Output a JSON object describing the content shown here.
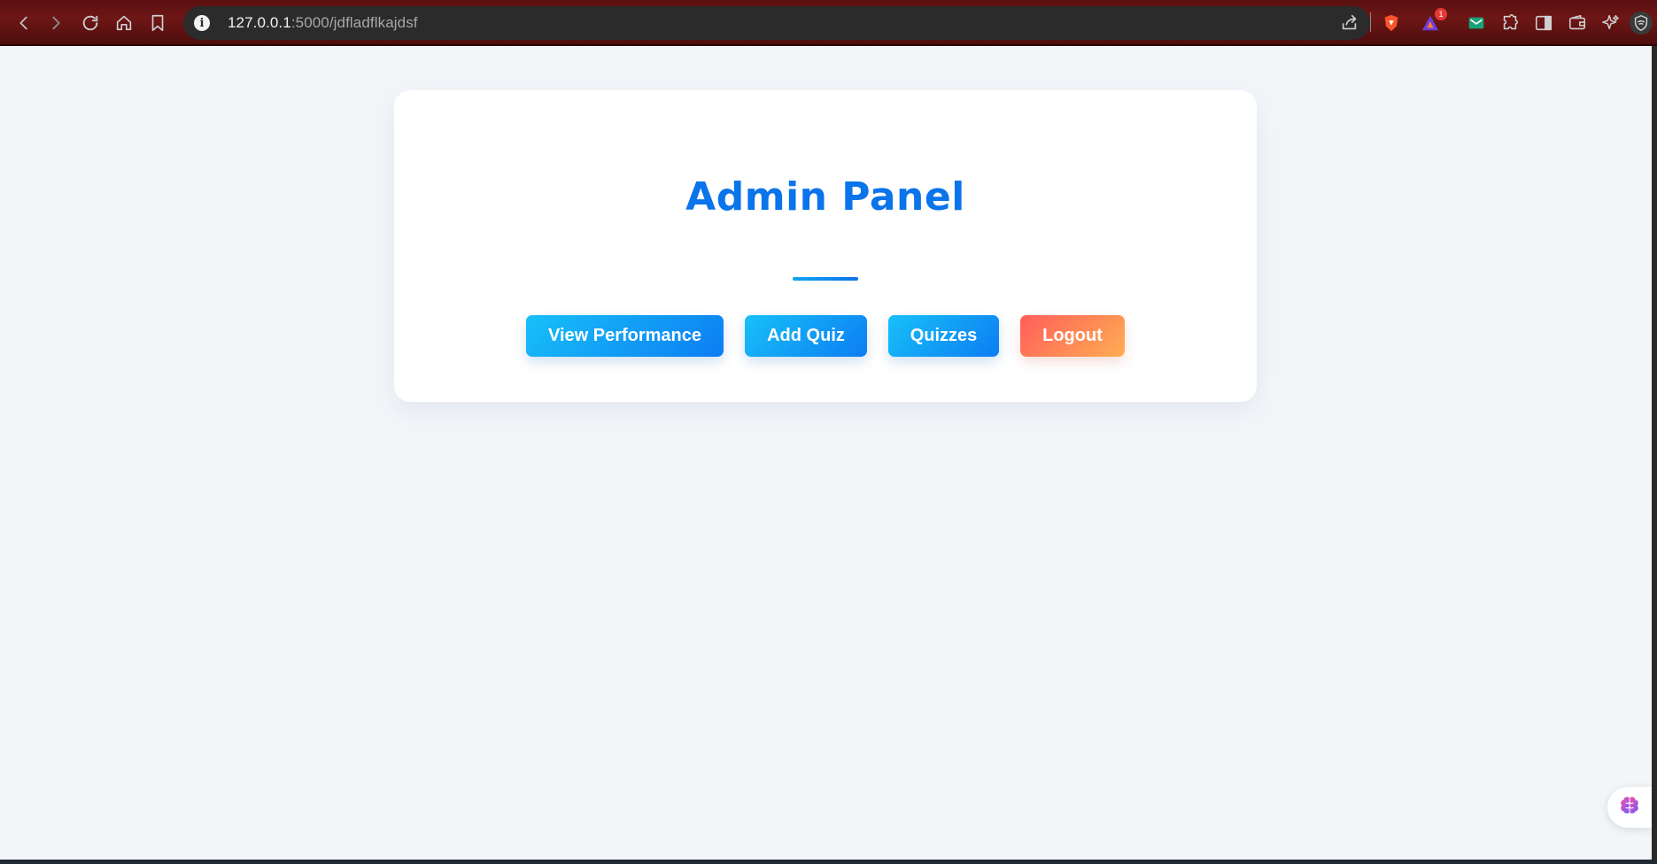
{
  "browser": {
    "url_host": "127.0.0.1",
    "url_path": ":5000/jdfladflkajdsf",
    "notification_count": "1",
    "icons": [
      "back-icon",
      "forward-icon",
      "reload-icon",
      "home-icon",
      "bookmark-icon",
      "info-icon",
      "share-icon",
      "brave-shields-icon",
      "brave-rewards-icon",
      "email-extension-icon",
      "extensions-icon",
      "sidebar-icon",
      "wallet-icon",
      "leo-ai-icon",
      "vpn-icon"
    ]
  },
  "page": {
    "title": "Admin Panel",
    "buttons": {
      "view_performance": "View Performance",
      "add_quiz": "Add Quiz",
      "quizzes": "Quizzes",
      "logout": "Logout"
    },
    "colors": {
      "title": "#0a74ea",
      "button_blue_start": "#18c0f8",
      "button_blue_end": "#0c7df3",
      "button_logout_start": "#ff5e5b",
      "button_logout_end": "#ffad52",
      "page_background": "#f3f6f9"
    },
    "floating_widget_icon": "brain-icon"
  }
}
